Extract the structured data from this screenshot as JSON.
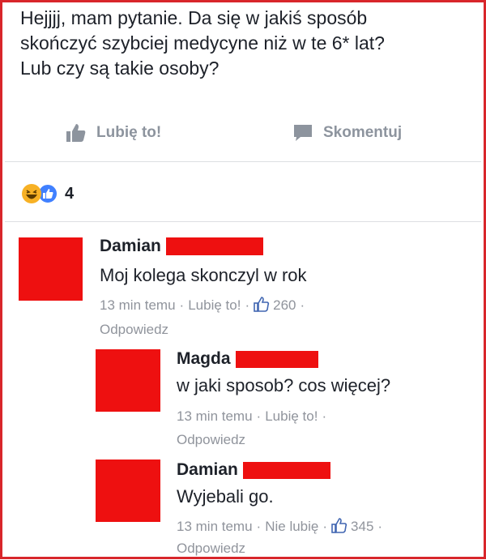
{
  "post": {
    "lines": [
      "Hejjjj, mam pytanie. Da się w jakiś sposób",
      "skończyć szybciej medycyne niż w te 6* lat?",
      "Lub czy są takie osoby?"
    ]
  },
  "actions": {
    "like_label": "Lubię to!",
    "comment_label": "Skomentuj"
  },
  "reactions": {
    "count": "4",
    "types": [
      "haha-icon",
      "like-icon"
    ]
  },
  "comments": [
    {
      "name": "Damian",
      "text": "Moj kolega skonczyl w rok",
      "time": "13 min temu",
      "like_label": "Lubię to!",
      "likes": "260",
      "reply_label": "Odpowiedz"
    },
    {
      "name": "Magda",
      "text": "w jaki sposob? cos więcej?",
      "time": "13 min temu",
      "like_label": "Lubię to!",
      "reply_label": "Odpowiedz"
    },
    {
      "name": "Damian",
      "text": "Wyjebali go.",
      "time": "13 min temu",
      "like_label": "Nie lubię",
      "likes": "345",
      "reply_label": "Odpowiedz"
    }
  ],
  "colors": {
    "frame_border": "#d8262b",
    "redaction": "#ee1010",
    "meta_text": "#90949c",
    "like_blue": "#4267b2"
  }
}
